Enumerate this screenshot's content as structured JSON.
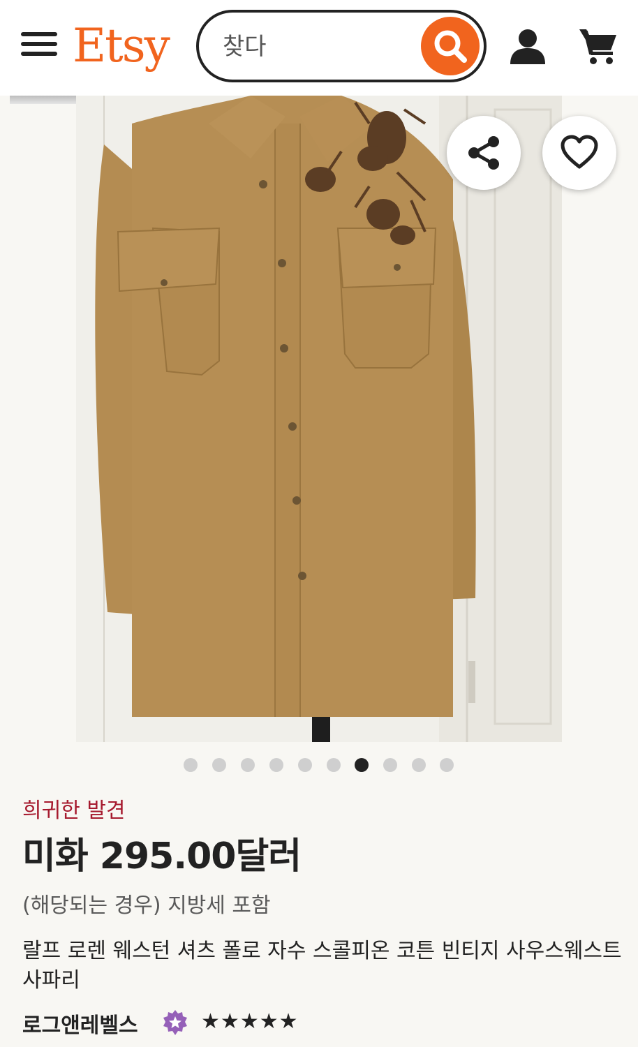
{
  "header": {
    "logo": "Etsy",
    "search_placeholder": "찾다",
    "brand_color": "#f1641e"
  },
  "gallery": {
    "image_alt": "Khaki long-sleeve western shirt on a dress form with brown scorpion embroidery on the shoulder",
    "total_images": 10,
    "active_index": 6
  },
  "listing": {
    "badge": "희귀한 발견",
    "price": "미화 295.00달러",
    "tax_note": "(해당되는 경우) 지방세 포함",
    "title": "랄프 로렌 웨스턴 셔츠 폴로 자수 스콜피온 코튼 빈티지 사우스웨스트 사파리",
    "shop_name": "로그앤레벨스",
    "rating": 5,
    "star_glyph": "★",
    "star_seller_color": "#9560b8",
    "badge_color": "#a61a2e"
  },
  "icons": {
    "menu": "menu-icon",
    "search": "search-icon",
    "user": "user-icon",
    "cart": "cart-icon",
    "share": "share-icon",
    "favorite": "heart-icon",
    "star_seller": "star-seller-icon"
  }
}
